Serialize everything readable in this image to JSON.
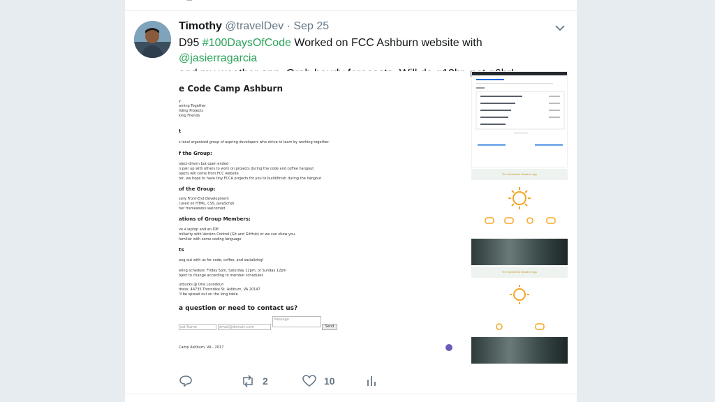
{
  "tweet": {
    "display_name": "Timothy",
    "handle": "@travelDev",
    "separator": "·",
    "date": "Sep 25",
    "text_prefix": "D95 ",
    "hashtag": "#100DaysOfCode",
    "text_mid": " Worked on FCC Ashburn website with ",
    "mention": "@jasierragarcia",
    "text_line2": "and my weather app. Grab hourly forecasts. Will do q12hr, not q6hr!",
    "retweet_count": "2",
    "like_count": "10"
  },
  "media": {
    "main_screenshot": {
      "title": "e Code Camp Ashburn",
      "lines_intro": "y\naming Together\nilding Projects\nking Friends",
      "heading_about": "t",
      "about_text": "s local organized group of aspring developers who strive to learn by working together.",
      "heading_group": "f the Group:",
      "group_text": "oject-driven but open ended\nn pair up with others to work on projects during the code and coffee hangout\nojects will come from FCC website\nter, we hope to have tiny FCCA projects for you to build/finish during the hangout",
      "heading_of_group": "of the Group:",
      "of_group_text": "ssily Front-End Development\ncused on HTML, CSS, JavaScript\nher frameworks welcomed",
      "heading_members": "ations of Group Members:",
      "members_text": "ve a laptop and an IDE\nmiliarity with Version Control (Git and GitHub) or we can show you\nfamiliar with some coding language",
      "heading_events": "ts",
      "events_text": "ang out with us for code, coffee, and socializing!",
      "schedule_text": "eting schedule: Friday 5pm, Saturday 12pm, or Sunday 12pm\nbject to change according to member schedules",
      "location_text": "urbucks @ One Loundoun\ndress: 44735 Thorndike St, Ashburn, VA 20147\n'll be spread out on the long table",
      "contact_heading": "a question or need to contact us?",
      "field_name": "ast Name",
      "field_email": "email@domain.com",
      "field_message": "Message",
      "send_label": "Send",
      "footer": "Camp Ashburn, VA - 2017"
    },
    "weather_title_1": "The Wonderful Weather App",
    "weather_title_2": "The Wonderful Weather App"
  },
  "icons": {
    "reply": "reply-icon",
    "retweet": "retweet-icon",
    "like": "heart-icon",
    "analytics": "analytics-icon",
    "caret": "chevron-down-icon",
    "github": "github-icon"
  },
  "colors": {
    "hashtag": "#2aa35a",
    "icon_gray": "#657786",
    "sun": "#f5a623"
  }
}
